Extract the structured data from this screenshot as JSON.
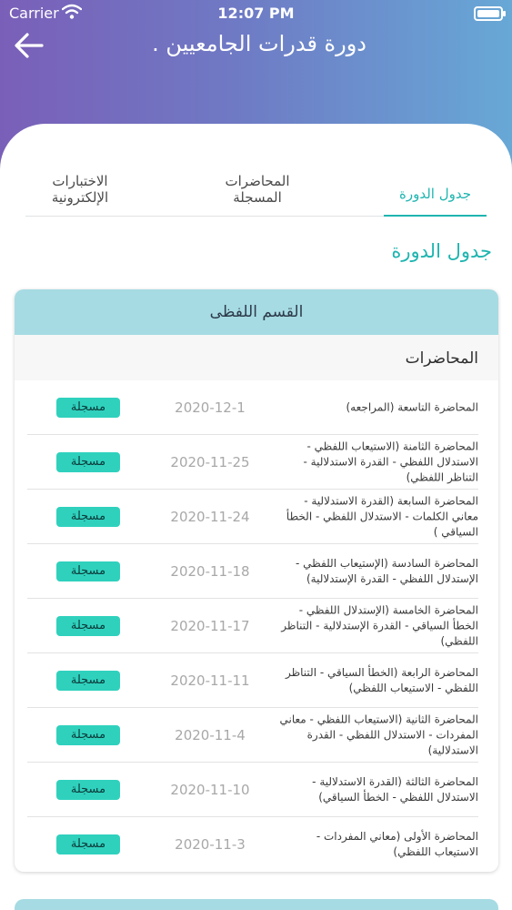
{
  "status_bar": {
    "carrier": "Carrier",
    "time": "12:07 PM"
  },
  "header": {
    "title": "دورة قدرات الجامعيين ."
  },
  "tabs": [
    {
      "label": "جدول الدورة",
      "active": true
    },
    {
      "label": "المحاضرات المسجلة",
      "active": false
    },
    {
      "label": "الاختبارات الإلكترونية",
      "active": false
    }
  ],
  "section_title": "جدول الدورة",
  "card": {
    "title": "القسم اللفظى",
    "lectures_label": "المحاضرات",
    "rows": [
      {
        "title": "المحاضرة التاسعة (المراجعه)",
        "date": "2020-12-1",
        "badge": "مسجلة"
      },
      {
        "title": "المحاضرة الثامنة (الاستيعاب اللفظي - الاستدلال اللفظي - القدرة الاستدلالية - التناظر اللفظي)",
        "date": "2020-11-25",
        "badge": "مسجلة"
      },
      {
        "title": "المحاضرة السابعة (القدرة الاستدلالية - معاني الكلمات - الاستدلال اللفظي - الخطأ السياقي )",
        "date": "2020-11-24",
        "badge": "مسجلة"
      },
      {
        "title": "المحاضرة السادسة (الإستيعاب اللفظي - الإستدلال اللفظي - القدرة الإستدلالية)",
        "date": "2020-11-18",
        "badge": "مسجلة"
      },
      {
        "title": "المحاضرة الخامسة (الإستدلال اللفظي - الخطأ السياقي - القدرة الإستدلالية - التناظر اللفظي)",
        "date": "2020-11-17",
        "badge": "مسجلة"
      },
      {
        "title": "المحاضرة الرابعة (الخطأ السياقي - التناظر اللفظي - الاستيعاب اللفظي)",
        "date": "2020-11-11",
        "badge": "مسجلة"
      },
      {
        "title": "المحاضرة الثانية (الاستيعاب اللفظي - معاني المفردات - الاستدلال اللفظي - القدرة الاستدلالية)",
        "date": "2020-11-4",
        "badge": "مسجلة"
      },
      {
        "title": "المحاضرة الثالثة (القدرة الاستدلالية - الاستدلال اللفظي - الخطأ السياقي)",
        "date": "2020-11-10",
        "badge": "مسجلة"
      },
      {
        "title": "المحاضرة الأولى (معاني المفردات - الاستيعاب اللفظي)",
        "date": "2020-11-3",
        "badge": "مسجلة"
      }
    ]
  },
  "colors": {
    "accent": "#1fb5b0",
    "badge": "#2fd1bd",
    "card_header": "#a6dbe3"
  },
  "icons": {
    "back": "arrow-left-icon",
    "wifi": "wifi-icon",
    "battery": "battery-icon"
  }
}
